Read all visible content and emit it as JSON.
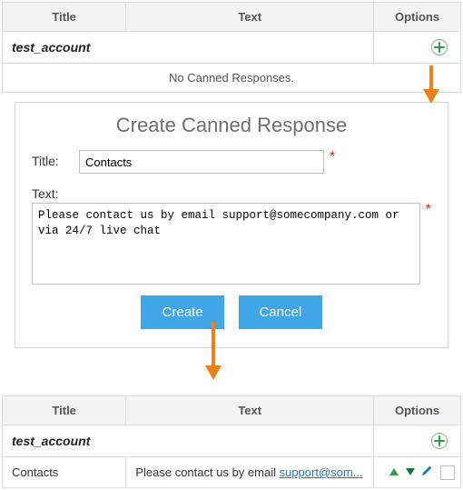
{
  "table1": {
    "headers": {
      "title": "Title",
      "text": "Text",
      "options": "Options"
    },
    "account": "test_account",
    "empty_msg": "No Canned Responses."
  },
  "form": {
    "heading": "Create Canned Response",
    "title_label": "Title:",
    "title_value": "Contacts",
    "text_label": "Text:",
    "text_value": "Please contact us by email support@somecompany.com or via 24/7 live chat",
    "create_btn": "Create",
    "cancel_btn": "Cancel"
  },
  "table2": {
    "headers": {
      "title": "Title",
      "text": "Text",
      "options": "Options"
    },
    "account": "test_account",
    "row": {
      "title": "Contacts",
      "text_prefix": "Please contact us by email ",
      "text_link": "support@som..."
    }
  },
  "colors": {
    "arrow": "#ef7f1a",
    "btn": "#41a6e6",
    "plus": "#2f9e44",
    "up": "#2f9e44",
    "down": "#0a7a3b",
    "edit": "#1f76c6"
  }
}
